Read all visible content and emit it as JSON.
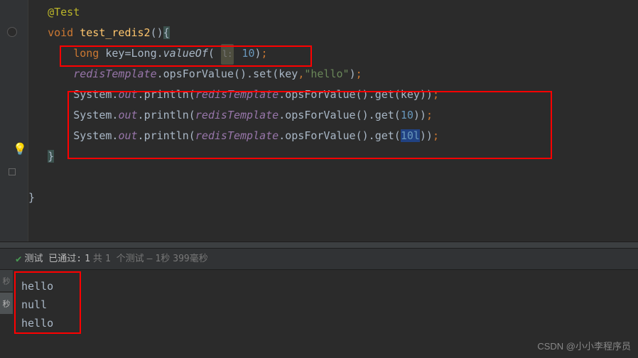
{
  "code": {
    "annotation": "@Test",
    "void": "void",
    "method_name": "test_redis2",
    "long_kw": "long",
    "key_var": "key",
    "long_class": "Long",
    "valueOf": "valueOf",
    "hint_l": "l:",
    "ten": "10",
    "redis_tmpl": "redisTemplate",
    "opsForValue": "opsForValue",
    "set": "set",
    "get": "get",
    "key_arg": "key",
    "hello_str": "\"hello\"",
    "system": "System",
    "out": "out",
    "println": "println",
    "ten_l": "10l"
  },
  "test_status": {
    "prefix": "测试 已通过:",
    "count": "1",
    "unit": "共",
    "total": "1 个测试",
    "dash": "–",
    "time1": "1秒",
    "time2": "399毫秒"
  },
  "console": {
    "tab1": "秒",
    "tab2": "秒",
    "line1": "hello",
    "line2": "null",
    "line3": "hello"
  },
  "watermark": "CSDN @小小李程序员"
}
